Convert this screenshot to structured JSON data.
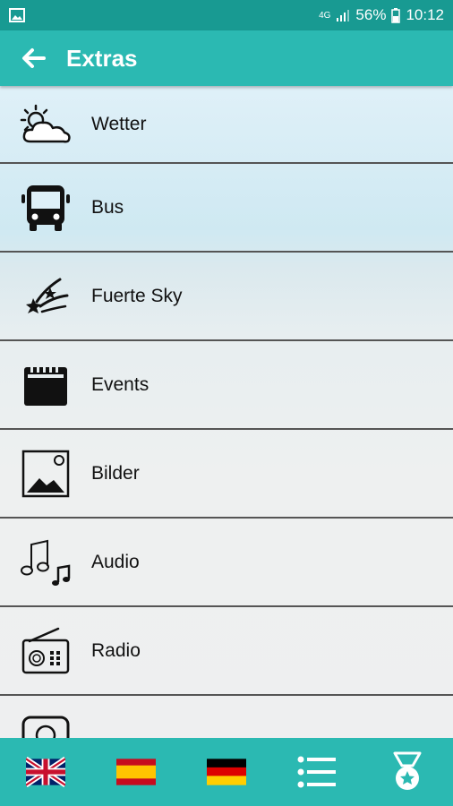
{
  "status_bar": {
    "network": "4G",
    "battery": "56%",
    "time": "10:12"
  },
  "app_bar": {
    "title": "Extras"
  },
  "menu": [
    {
      "label": "Wetter",
      "icon": "weather-icon"
    },
    {
      "label": "Bus",
      "icon": "bus-icon"
    },
    {
      "label": "Fuerte Sky",
      "icon": "shooting-stars-icon"
    },
    {
      "label": "Events",
      "icon": "calendar-icon"
    },
    {
      "label": "Bilder",
      "icon": "image-icon"
    },
    {
      "label": "Audio",
      "icon": "music-notes-icon"
    },
    {
      "label": "Radio",
      "icon": "radio-icon"
    }
  ],
  "bottom_nav": [
    "english-flag",
    "spanish-flag",
    "german-flag",
    "list-icon",
    "medal-icon"
  ]
}
